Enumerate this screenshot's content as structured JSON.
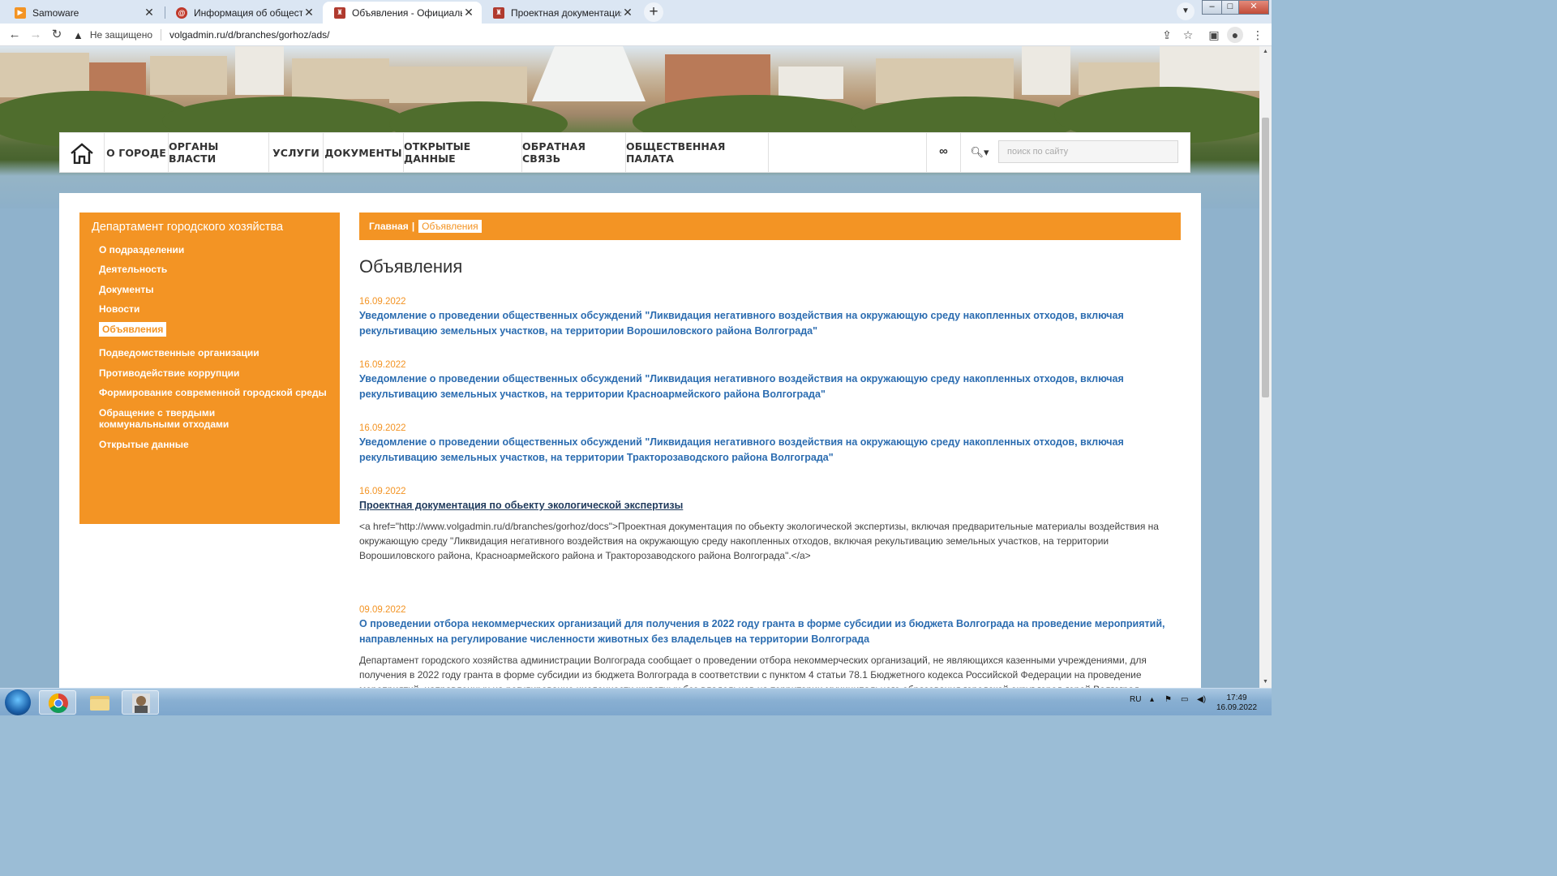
{
  "browser": {
    "tabs": [
      {
        "title": "Samoware",
        "favicon_color": "#f39424"
      },
      {
        "title": "Информация об общественных",
        "favicon_color": "#c0392b"
      },
      {
        "title": "Объявления - Официальный са",
        "favicon_color": "#c0392b",
        "active": true
      },
      {
        "title": "Проектная документация по об",
        "favicon_color": "#c0392b"
      }
    ],
    "security_label": "Не защищено",
    "url": "volgadmin.ru/d/branches/gorhoz/ads/"
  },
  "topnav": {
    "items": [
      "О ГОРОДЕ",
      "ОРГАНЫ ВЛАСТИ",
      "УСЛУГИ",
      "ДОКУМЕНТЫ",
      "ОТКРЫТЫЕ ДАННЫЕ",
      "ОБРАТНАЯ СВЯЗЬ",
      "ОБЩЕСТВЕННАЯ ПАЛАТА"
    ],
    "search_placeholder": "поиск по сайту"
  },
  "sidebar": {
    "title": "Департамент городского хозяйства",
    "items": [
      "О подразделении",
      "Деятельность",
      "Документы",
      "Новости",
      "Объявления",
      "Подведомственные организации",
      "Противодействие коррупции",
      "Формирование современной городской среды",
      "Обращение с твердыми коммунальными отходами",
      "Открытые данные"
    ],
    "active_index": 4
  },
  "breadcrumb": {
    "home": "Главная",
    "separator": "|",
    "current": "Объявления"
  },
  "page_title": "Объявления",
  "announcements": [
    {
      "date": "16.09.2022",
      "title": "Уведомление о проведении общественных обсуждений \"Ликвидация негативного воздействия на окружающую среду накопленных отходов, включая рекультивацию земельных участков, на территории Ворошиловского района Волгограда\""
    },
    {
      "date": "16.09.2022",
      "title": "Уведомление о проведении общественных обсуждений \"Ликвидация негативного воздействия на окружающую среду накопленных отходов, включая рекультивацию земельных участков, на территории Красноармейского района Волгограда\""
    },
    {
      "date": "16.09.2022",
      "title": "Уведомление о проведении общественных обсуждений \"Ликвидация негативного воздействия на окружающую среду накопленных отходов, включая рекультивацию земельных участков, на территории Тракторозаводского района Волгограда\""
    },
    {
      "date": "16.09.2022",
      "title": "Проектная документация по обьекту экологической экспертизы",
      "body": "<a href=\"http://www.volgadmin.ru/d/branches/gorhoz/docs\">Проектная документация по обьекту экологической экспертизы, включая предварительные материалы воздействия на окружающую среду \"Ликвидация негативного воздействия на окружающую среду накопленных отходов, включая рекультивацию земельных участков, на территории Ворошиловского района, Красноармейского района и Тракторозаводского района Волгограда\".</a>"
    },
    {
      "date": "09.09.2022",
      "title": "О проведении отбора некоммерческих организаций для получения в 2022 году гранта в форме субсидии из бюджета Волгограда на проведение мероприятий, направленных на регулирование численности животных без владельцев на территории Волгограда",
      "body": "Департамент городского хозяйства администрации Волгограда сообщает о проведении отбора некоммерческих организаций, не являющихся казенными учреждениями, для получения в 2022 году гранта в форме субсидии из бюджета Волгограда в соответствии с пунктом 4 статьи 78.1 Бюджетного кодекса Российской Федерации на проведение мероприятий, направленных на регулирование численности животных без владельцев на территории муниципального образования городской округ город-герой Волгоград"
    }
  ],
  "taskbar": {
    "lang": "RU",
    "time": "17:49",
    "date": "16.09.2022"
  },
  "colors": {
    "accent": "#f39424",
    "link": "#2b6cb0"
  }
}
